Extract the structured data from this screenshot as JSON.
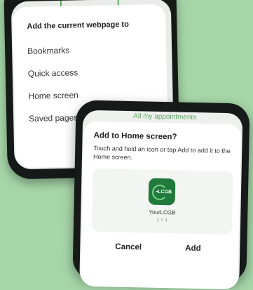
{
  "menu": {
    "heading": "Add the current webpage to",
    "options": [
      "Bookmarks",
      "Quick access",
      "Home screen",
      "Saved pages"
    ]
  },
  "background_hint": "All my appointments",
  "dialog": {
    "title": "Add to Home screen?",
    "description": "Touch and hold an icon or tap Add to add it to the Home screen.",
    "app": {
      "icon_text": "•LCGB",
      "name": "YourLCGB",
      "size": "1 × 1"
    },
    "cancel_label": "Cancel",
    "add_label": "Add"
  },
  "colors": {
    "background": "#a6d6a8",
    "app_icon": "#1f7a3b",
    "accent_green": "#4aa552"
  }
}
